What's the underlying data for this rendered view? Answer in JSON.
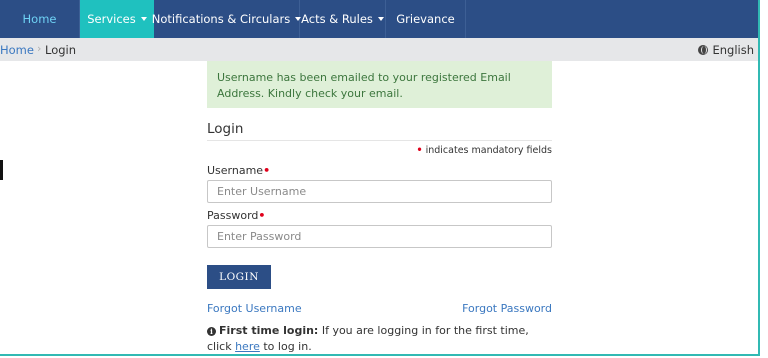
{
  "nav": {
    "items": [
      {
        "label": "Home"
      },
      {
        "label": "Services"
      },
      {
        "label": "Notifications & Circulars"
      },
      {
        "label": "Acts & Rules"
      },
      {
        "label": "Grievance"
      }
    ]
  },
  "breadcrumb": {
    "home": "Home",
    "separator": "›",
    "current": "Login"
  },
  "language": {
    "label": "English",
    "icon": "globe-icon"
  },
  "alert": {
    "message": "Username has been emailed to your registered Email Address. Kindly check your email."
  },
  "form": {
    "heading": "Login",
    "mandatory_star": "•",
    "mandatory_note": "indicates mandatory fields",
    "username_label": "Username",
    "username_placeholder": "Enter Username",
    "password_label": "Password",
    "password_placeholder": "Enter Password",
    "login_button": "LOGIN",
    "forgot_username": "Forgot Username",
    "forgot_password": "Forgot Password"
  },
  "first_time": {
    "icon": "info-icon",
    "bold": "First time login:",
    "text_before": " If you are logging in for the first time, click ",
    "link": "here",
    "text_after": " to log in."
  },
  "colors": {
    "navbar": "#2c4e86",
    "active_tab": "#1fc1bf",
    "alert_bg": "#dff0d8",
    "alert_text": "#3c763d",
    "link": "#3b78c0",
    "required": "#e0001b"
  }
}
